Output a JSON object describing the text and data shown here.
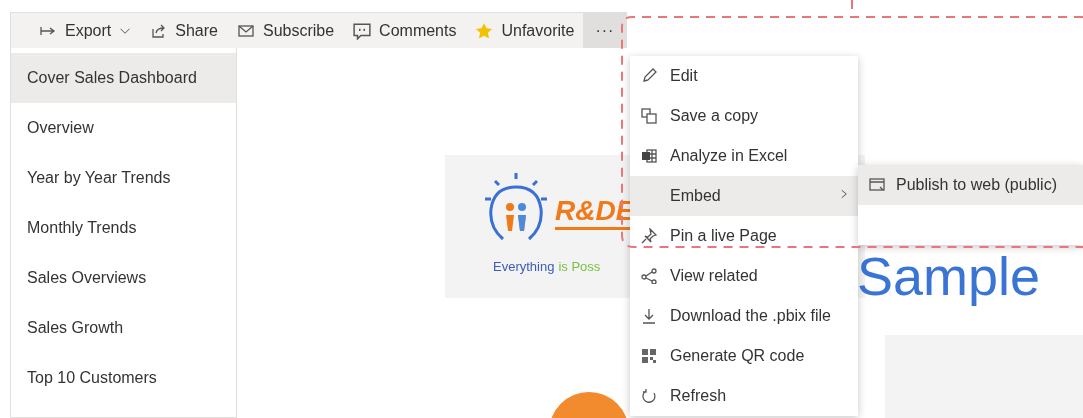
{
  "toolbar": {
    "items": [
      {
        "label": "Export",
        "kind": "dropdown"
      },
      {
        "label": "Share",
        "kind": "plain"
      },
      {
        "label": "Subscribe",
        "kind": "plain"
      },
      {
        "label": "Comments",
        "kind": "plain"
      },
      {
        "label": "Unfavorite",
        "kind": "plain"
      },
      {
        "label": "···",
        "kind": "more",
        "selected": true
      }
    ]
  },
  "sidebar": {
    "items": [
      {
        "label": "Cover Sales Dashboard",
        "selected": true
      },
      {
        "label": "Overview",
        "selected": false
      },
      {
        "label": "Year by Year Trends",
        "selected": false
      },
      {
        "label": "Monthly Trends",
        "selected": false
      },
      {
        "label": "Sales Overviews",
        "selected": false
      },
      {
        "label": "Sales Growth",
        "selected": false
      },
      {
        "label": "Top 10 Customers",
        "selected": false
      }
    ]
  },
  "canvas": {
    "logo": {
      "wordmark": "R&DE",
      "tagline": [
        "Everything",
        "is Poss"
      ]
    },
    "title": "Sample"
  },
  "menu": {
    "items": [
      {
        "label": "Edit",
        "kind": "action",
        "selected": false
      },
      {
        "label": "Save a copy",
        "kind": "action",
        "selected": false
      },
      {
        "label": "Analyze in Excel",
        "kind": "action",
        "selected": false
      },
      {
        "label": "Embed",
        "kind": "submenu",
        "selected": true
      },
      {
        "label": "Pin a live Page",
        "kind": "action",
        "selected": false
      },
      {
        "label": "View related",
        "kind": "action",
        "selected": false
      },
      {
        "label": "Download the .pbix file",
        "kind": "action",
        "selected": false
      },
      {
        "label": "Generate QR code",
        "kind": "action",
        "selected": false
      },
      {
        "label": "Refresh",
        "kind": "action",
        "selected": false
      }
    ]
  },
  "submenu": {
    "items": [
      {
        "label": "Publish to web (public)",
        "selected": true
      }
    ]
  }
}
